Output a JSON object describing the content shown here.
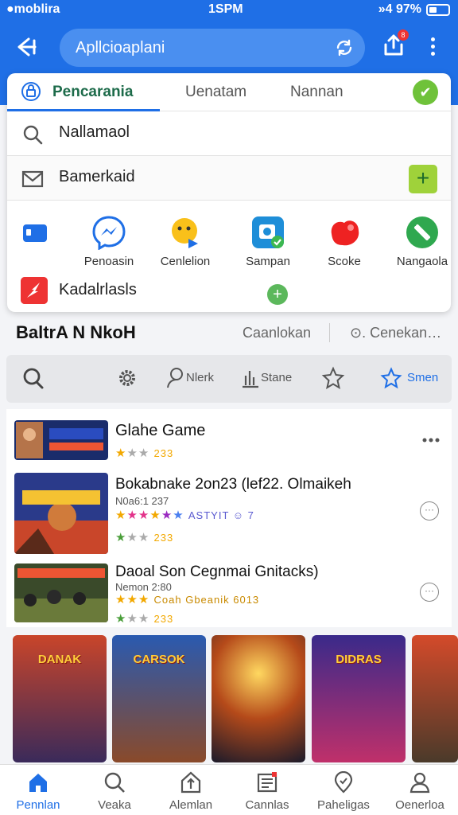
{
  "status": {
    "left": "●moblira",
    "time": "1SPM",
    "right": "»4 97%"
  },
  "appbar": {
    "search_text": "Apllcioaplani",
    "badge": "8"
  },
  "tabs": [
    {
      "label": "Pencarania"
    },
    {
      "label": "Uenatam"
    },
    {
      "label": "Nannan"
    }
  ],
  "rows": [
    {
      "label": "Nallamaol"
    },
    {
      "label": "Bamerkaid"
    }
  ],
  "apps": [
    {
      "label": ""
    },
    {
      "label": "Penoasin"
    },
    {
      "label": "Cenlelion"
    },
    {
      "label": "Sampan"
    },
    {
      "label": "Scoke"
    },
    {
      "label": "Nangaola"
    }
  ],
  "kadalrlasls": "Kadalrlasls",
  "section": {
    "title": "BaltrA N NkoH",
    "link1": "Caanlokan",
    "link2": "⊙. Cenekan…"
  },
  "toolbar": [
    {
      "label": ""
    },
    {
      "label": ""
    },
    {
      "label": "Nlerk"
    },
    {
      "label": "Stane"
    },
    {
      "label": ""
    },
    {
      "label": "Smen"
    }
  ],
  "games": [
    {
      "title": "Glahe Game",
      "sub": "",
      "rating_count": "233",
      "ratings2": ""
    },
    {
      "title": "Bokabnake 2on23 (lef22. Olmaikeh",
      "sub": "N0a6:1 237",
      "rating_count": "233",
      "ratings2": "ASTYIT ☺ 7"
    },
    {
      "title": "Daoal Son Cegnmai Gnitacks)",
      "sub": "Nemon 2:80",
      "rating_count": "233",
      "ratings2": "Coah Gbeanik 6013"
    }
  ],
  "banners": [
    "DANAK",
    "CARSOK",
    "",
    "DIDRAS",
    ""
  ],
  "nav": [
    {
      "label": "Pennlan"
    },
    {
      "label": "Veaka"
    },
    {
      "label": "Alemlan"
    },
    {
      "label": "Cannlas"
    },
    {
      "label": "Paheligas"
    },
    {
      "label": "Oenerloa"
    }
  ],
  "colors": {
    "primary": "#1f6fe6",
    "accent_green": "#6fc23a",
    "star": "#f2a800"
  }
}
